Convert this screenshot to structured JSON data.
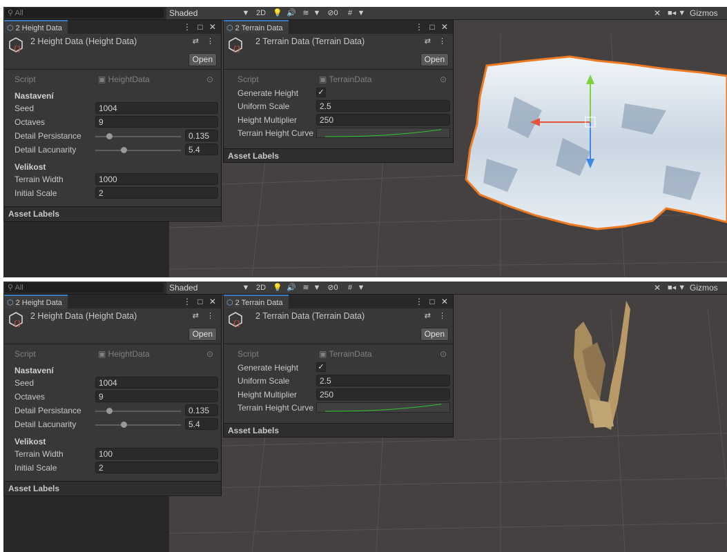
{
  "shots": [
    {
      "search_placeholder": "All",
      "toolbar": {
        "shaded": "Shaded",
        "dropdown_arrow": "▼",
        "mode_2d": "2D",
        "light": "💡",
        "audio": "🔊",
        "effects": "≋",
        "effects_arrow": "▼",
        "hidden": "⊘0",
        "grid": "#",
        "grid_arrow": "▼",
        "tools": "✕",
        "camera": "■◂ ▼",
        "gizmos": "Gizmos"
      },
      "height_panel": {
        "tab": "2 Height Data",
        "tab_controls": "⋮ □ ✕",
        "title": "2 Height Data (Height Data)",
        "header_controls": "⇄ ⋮",
        "open": "Open",
        "script_label": "Script",
        "script_value": "HeightData",
        "section1": "Nastavení",
        "seed_label": "Seed",
        "seed_value": "1004",
        "octaves_label": "Octaves",
        "octaves_value": "9",
        "persistance_label": "Detail Persistance",
        "persistance_value": "0.135",
        "persistance_fraction": 0.16,
        "lacunarity_label": "Detail Lacunarity",
        "lacunarity_value": "5.4",
        "lacunarity_fraction": 0.33,
        "section2": "Velikost",
        "width_label": "Terrain Width",
        "width_value": "1000",
        "scale_label": "Initial Scale",
        "scale_value": "2",
        "asset_labels": "Asset Labels"
      },
      "terrain_panel": {
        "tab": "2 Terrain Data",
        "tab_controls": "⋮ □ ✕",
        "title": "2 Terrain Data (Terrain Data)",
        "header_controls": "⇄ ⋮",
        "open": "Open",
        "script_label": "Script",
        "script_value": "TerrainData",
        "generate_label": "Generate Height",
        "generate_check": "✓",
        "uniform_label": "Uniform Scale",
        "uniform_value": "2.5",
        "multiplier_label": "Height Multiplier",
        "multiplier_value": "250",
        "curve_label": "Terrain Height Curve",
        "asset_labels": "Asset Labels"
      }
    },
    {
      "search_placeholder": "All",
      "toolbar": {
        "shaded": "Shaded",
        "dropdown_arrow": "▼",
        "mode_2d": "2D",
        "light": "💡",
        "audio": "🔊",
        "effects": "≋",
        "effects_arrow": "▼",
        "hidden": "⊘0",
        "grid": "#",
        "grid_arrow": "▼",
        "tools": "✕",
        "camera": "■◂ ▼",
        "gizmos": "Gizmos"
      },
      "height_panel": {
        "tab": "2 Height Data",
        "tab_controls": "⋮ □ ✕",
        "title": "2 Height Data (Height Data)",
        "header_controls": "⇄ ⋮",
        "open": "Open",
        "script_label": "Script",
        "script_value": "HeightData",
        "section1": "Nastavení",
        "seed_label": "Seed",
        "seed_value": "1004",
        "octaves_label": "Octaves",
        "octaves_value": "9",
        "persistance_label": "Detail Persistance",
        "persistance_value": "0.135",
        "persistance_fraction": 0.16,
        "lacunarity_label": "Detail Lacunarity",
        "lacunarity_value": "5.4",
        "lacunarity_fraction": 0.33,
        "section2": "Velikost",
        "width_label": "Terrain Width",
        "width_value": "100",
        "scale_label": "Initial Scale",
        "scale_value": "2",
        "asset_labels": "Asset Labels"
      },
      "terrain_panel": {
        "tab": "2 Terrain Data",
        "tab_controls": "⋮ □ ✕",
        "title": "2 Terrain Data (Terrain Data)",
        "header_controls": "⇄ ⋮",
        "open": "Open",
        "script_label": "Script",
        "script_value": "TerrainData",
        "generate_label": "Generate Height",
        "generate_check": "✓",
        "uniform_label": "Uniform Scale",
        "uniform_value": "2.5",
        "multiplier_label": "Height Multiplier",
        "multiplier_value": "250",
        "curve_label": "Terrain Height Curve",
        "asset_labels": "Asset Labels"
      }
    }
  ],
  "colors": {
    "accent": "#3a79bb",
    "selection_outline": "#ee7a22",
    "curve": "#2ec82e",
    "terrain_light": "#e8eef4",
    "terrain_brown": "#a98c5e"
  }
}
